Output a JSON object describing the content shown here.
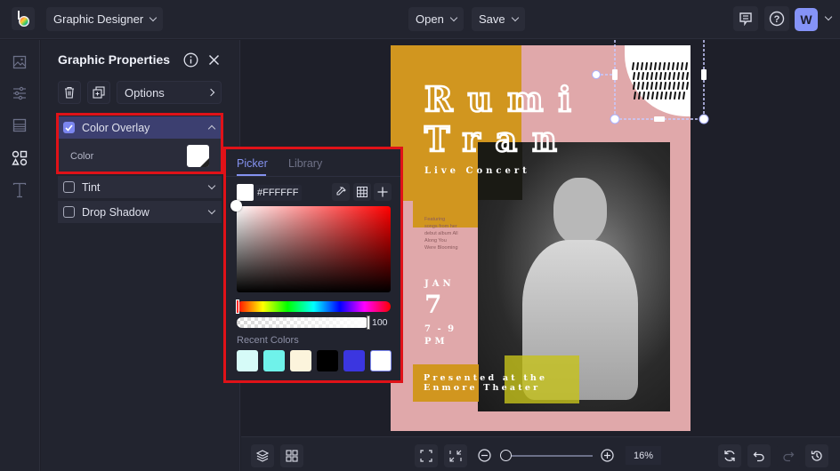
{
  "topbar": {
    "app_menu_label": "Graphic Designer",
    "open_label": "Open",
    "save_label": "Save",
    "avatar_initial": "W",
    "icons": [
      "logo-icon",
      "comments-icon",
      "help-icon"
    ]
  },
  "left_rail": {
    "items": [
      {
        "name": "image",
        "icon": "image-icon"
      },
      {
        "name": "adjustments",
        "icon": "sliders-icon"
      },
      {
        "name": "layout",
        "icon": "layout-icon"
      },
      {
        "name": "graphics",
        "icon": "shapes-icon",
        "active": true
      },
      {
        "name": "text",
        "icon": "text-icon"
      }
    ]
  },
  "panel": {
    "title": "Graphic Properties",
    "options_label": "Options",
    "sections": [
      {
        "label": "Color Overlay",
        "checked": true,
        "expanded": true
      },
      {
        "label": "Tint",
        "checked": false,
        "expanded": false
      },
      {
        "label": "Drop Shadow",
        "checked": false,
        "expanded": false
      }
    ],
    "color_label": "Color",
    "color_value": "#FFFFFF"
  },
  "picker": {
    "tabs": [
      "Picker",
      "Library"
    ],
    "active_tab": "Picker",
    "hex_value": "#FFFFFF",
    "hue": 0,
    "opacity": "100",
    "recent_label": "Recent Colors",
    "recent_colors": [
      "#d6fbf8",
      "#6ff2ea",
      "#fcf4dc",
      "#000000",
      "#3b36e0",
      "#ffffff"
    ]
  },
  "poster": {
    "title_line1": "Rumi",
    "title_line2": "Tran",
    "subtitle": "Live Concert",
    "blurb": "Featuring songs from her debut album All Along You Were Blooming",
    "month": "JAN",
    "day": "7",
    "time_line1": "7 - 9",
    "time_line2": "PM",
    "venue_line1": "Presented at the",
    "venue_line2": "Enmore Theater",
    "colors": {
      "gold": "#d1961f",
      "pink": "#e0a8aa",
      "yellow": "#c6c21a"
    }
  },
  "bottombar": {
    "zoom_percent": "16%",
    "zoom_value": 0.0
  }
}
